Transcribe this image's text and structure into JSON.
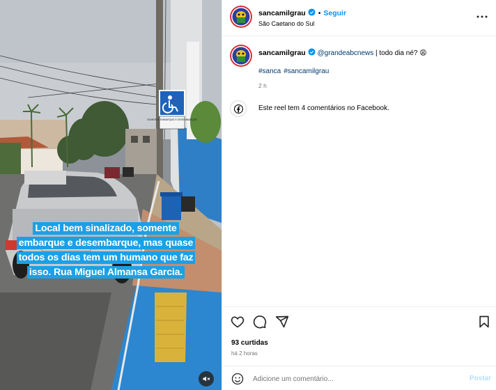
{
  "post": {
    "username": "sancamilgrau",
    "follow_label": "Seguir",
    "dot": "•",
    "location": "São Caetano do Sul",
    "more_icon": "more-horizontal-icon"
  },
  "caption": {
    "username": "sancamilgrau",
    "mention": "@grandeabcnews",
    "text": " | todo dia né? 😩",
    "hashtags": [
      "#sanca",
      "#sancamilgrau"
    ],
    "time": "2 h"
  },
  "facebook": {
    "icon": "facebook-icon",
    "text": "Este reel tem 4 comentários no Facebook."
  },
  "media": {
    "overlay_text": "Local bem sinalizado, somente embarque e desembarque, mas quase todos os dias tem um humano que faz isso. Rua Miguel Almansa Garcia.",
    "sign_text": "SOMENTE EMBARQUE E DESEMBARQUE",
    "mute_icon": "speaker-muted-icon"
  },
  "actions": {
    "likes": "93 curtidas",
    "time_ago": "há 2 horas",
    "icons": [
      "heart-icon",
      "comment-icon",
      "share-icon",
      "bookmark-icon"
    ]
  },
  "comment": {
    "placeholder": "Adicione um comentário...",
    "post_label": "Postar",
    "emoji_icon": "emoji-icon"
  },
  "colors": {
    "link_blue": "#0095f6",
    "caption_box": "#1ba0e6",
    "mention": "#00376b",
    "muted_text": "#737373"
  }
}
